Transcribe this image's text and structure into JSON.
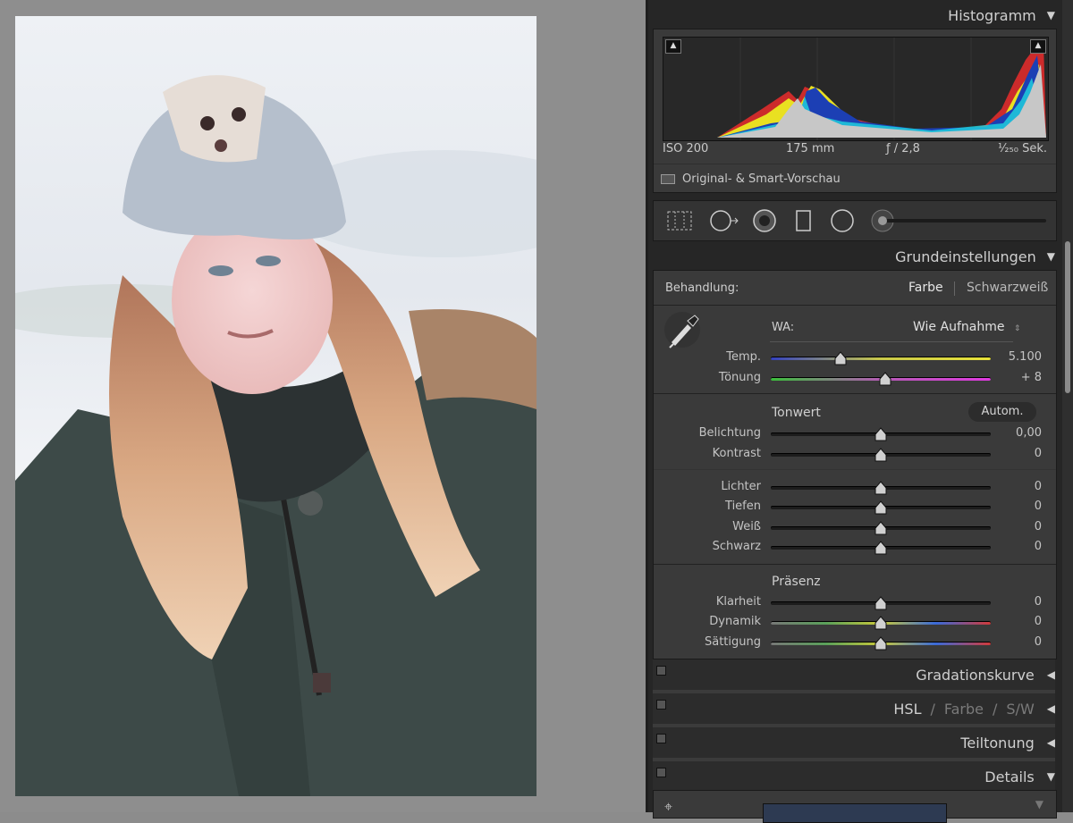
{
  "histogram": {
    "title": "Histogramm",
    "iso": "ISO 200",
    "focal": "175 mm",
    "aperture": "ƒ / 2,8",
    "shutter": "¹⁄₂₅₀ Sek.",
    "preview_label": "Original- & Smart-Vorschau"
  },
  "basic": {
    "title": "Grundeinstellungen",
    "treatment_label": "Behandlung:",
    "color_label": "Farbe",
    "bw_label": "Schwarzweiß",
    "wb_label": "WA:",
    "wb_value": "Wie Aufnahme",
    "temp_label": "Temp.",
    "temp_value": "5.100",
    "tint_label": "Tönung",
    "tint_value": "+ 8",
    "tone_title": "Tonwert",
    "auto_label": "Autom.",
    "exposure_label": "Belichtung",
    "exposure_value": "0,00",
    "contrast_label": "Kontrast",
    "contrast_value": "0",
    "highlights_label": "Lichter",
    "highlights_value": "0",
    "shadows_label": "Tiefen",
    "shadows_value": "0",
    "whites_label": "Weiß",
    "whites_value": "0",
    "blacks_label": "Schwarz",
    "blacks_value": "0",
    "presence_title": "Präsenz",
    "clarity_label": "Klarheit",
    "clarity_value": "0",
    "vibrance_label": "Dynamik",
    "vibrance_value": "0",
    "saturation_label": "Sättigung",
    "saturation_value": "0"
  },
  "panels": {
    "tone_curve": "Gradationskurve",
    "hsl": "HSL",
    "hsl_sep1": "/",
    "hsl_color": "Farbe",
    "hsl_sep2": "/",
    "hsl_bw": "S/W",
    "split_toning": "Teiltonung",
    "details": "Details"
  },
  "colors": {
    "panel_bg": "#262626",
    "section_bg": "#3a3a3a",
    "canvas_bg": "#8e8e8e"
  }
}
